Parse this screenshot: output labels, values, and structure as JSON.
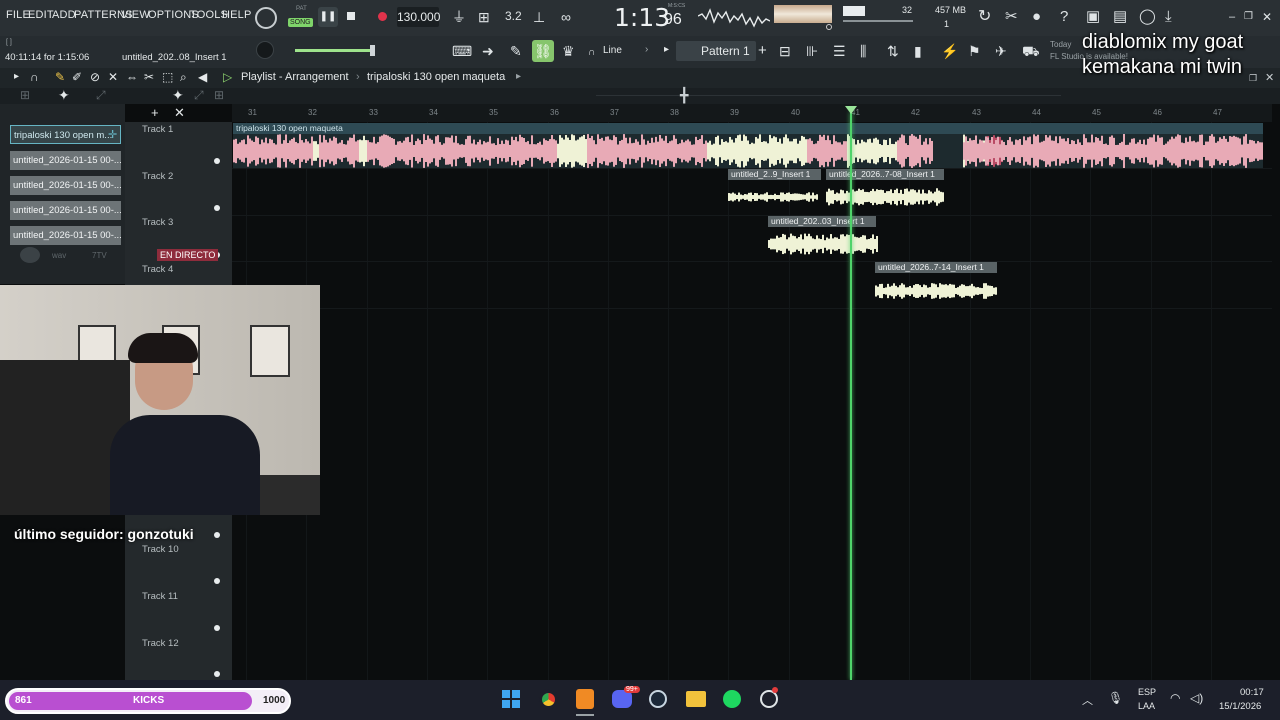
{
  "menu": [
    "FILE",
    "EDIT",
    "ADD",
    "PATTERNS",
    "VIEW",
    "OPTIONS",
    "TOOLS",
    "HELP"
  ],
  "transport": {
    "mode_pat": "PAT",
    "mode_song": "SONG",
    "tempo": "130.000",
    "time": "1:13",
    "time_small": "96",
    "time_unit": "M:S:CS",
    "cpu_num": "32",
    "memory": "457 MB",
    "poly": "1"
  },
  "hint": {
    "elapsed": "40:11:14 for 1:15:06",
    "file": "untitled_202..08_Insert 1",
    "brackets": "[ ]",
    "today": "Today",
    "update": "FL Studio is available!"
  },
  "toolbar2": {
    "snap": "Line",
    "pattern": "Pattern 1"
  },
  "playlist": {
    "title": "Playlist - Arrangement",
    "arrangement": "tripaloski 130 open maqueta"
  },
  "browser": {
    "clips": [
      "tripaloski 130 open m...",
      "untitled_2026-01-15 00-...",
      "untitled_2026-01-15 00-...",
      "untitled_2026-01-15 00-...",
      "untitled_2026-01-15 00-..."
    ],
    "tags": [
      "wav",
      "7TV",
      "EN DIRECTO"
    ]
  },
  "ruler": [
    "31",
    "32",
    "33",
    "34",
    "35",
    "36",
    "37",
    "38",
    "39",
    "40",
    "41",
    "42",
    "43",
    "44",
    "45",
    "46",
    "47"
  ],
  "tracks": [
    {
      "name": "Track 1"
    },
    {
      "name": "Track 2"
    },
    {
      "name": "Track 3"
    },
    {
      "name": "Track 4"
    },
    {
      "name": "Track 10"
    },
    {
      "name": "Track 11"
    },
    {
      "name": "Track 12"
    }
  ],
  "clips": {
    "main": "tripaloski 130 open maqueta",
    "t2a": "untitled_2..9_Insert 1",
    "t2b": "untitled_2026..7-08_Insert 1",
    "t3": "untitled_202..03_Insert 1",
    "t4": "untitled_2026..7-14_Insert 1"
  },
  "overlay": {
    "line1": "diablomix my goat",
    "line2": "kemakana mi twin",
    "follower": "último seguidor: gonzotuki"
  },
  "kicks": {
    "current": "861",
    "label": "KICKS",
    "goal": "1000",
    "progress": 0.861
  },
  "taskbar": {
    "lang1": "ESP",
    "lang2": "LAA",
    "time": "00:17",
    "date": "15/1/2026",
    "badge": "99+"
  },
  "colors": {
    "waveform_main": "#e8aab6",
    "waveform_main_dark": "#b94a64",
    "waveform_light": "#eff2d6",
    "playhead": "#4fd36a",
    "accent_pink": "#b94fd1"
  }
}
